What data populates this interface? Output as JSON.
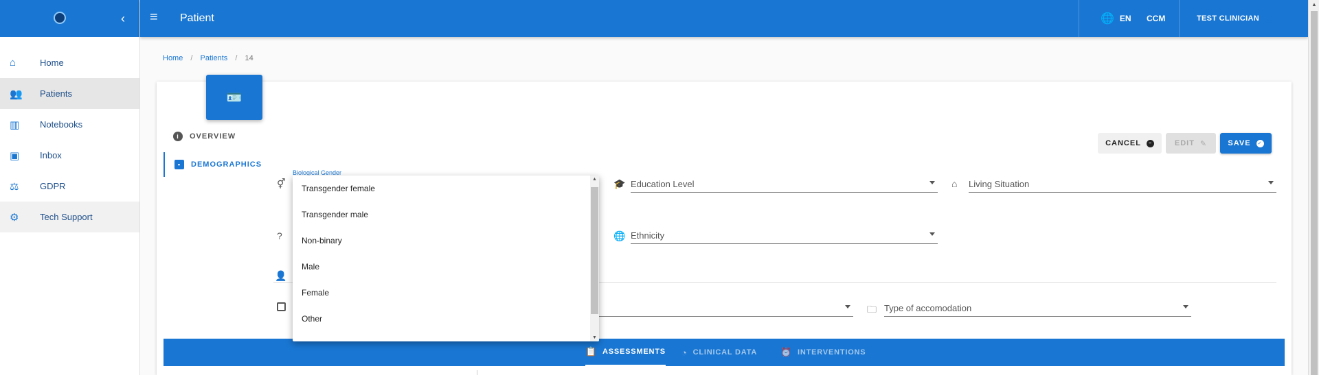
{
  "app": {
    "title": "Patient"
  },
  "sidebar": {
    "items": [
      {
        "label": "Home",
        "icon": "home-icon"
      },
      {
        "label": "Patients",
        "icon": "people-icon"
      },
      {
        "label": "Notebooks",
        "icon": "bar-chart-icon"
      },
      {
        "label": "Inbox",
        "icon": "inbox-icon"
      },
      {
        "label": "GDPR",
        "icon": "gavel-icon"
      },
      {
        "label": "Tech Support",
        "icon": "support-icon"
      }
    ]
  },
  "topbar": {
    "language": "EN",
    "ccm": "CCM",
    "user": "TEST CLINICIAN"
  },
  "breadcrumb": {
    "home": "Home",
    "patients": "Patients",
    "current": "14"
  },
  "tabs": {
    "overview": "OVERVIEW",
    "demographics": "DEMOGRAPHICS"
  },
  "buttons": {
    "cancel": "CANCEL",
    "edit": "EDIT",
    "save": "SAVE"
  },
  "fields": {
    "biological_gender_label": "Biological Gender",
    "education_level": "Education Level",
    "living_situation": "Living Situation",
    "ethnicity": "Ethnicity",
    "type_of_accommodation": "Type of accomodation"
  },
  "dropdown": {
    "options": [
      "Transgender female",
      "Transgender male",
      "Non-binary",
      "Male",
      "Female",
      "Other"
    ]
  },
  "bottom_tabs": {
    "assessments": "ASSESSMENTS",
    "clinical_data": "CLINICAL DATA",
    "interventions": "INTERVENTIONS"
  },
  "colors": {
    "primary": "#1976d2"
  }
}
